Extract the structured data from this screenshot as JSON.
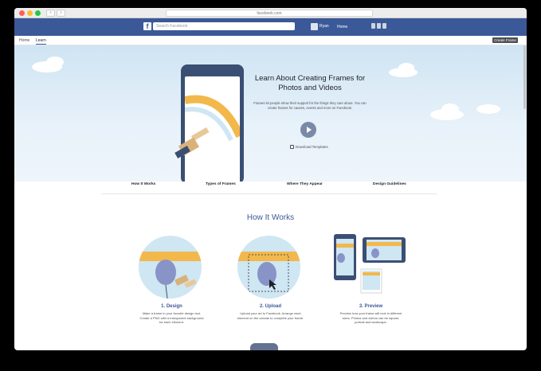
{
  "browser": {
    "url": "facebook.com",
    "back_label": "‹",
    "forward_label": "›"
  },
  "fbbar": {
    "logo": "f",
    "search_placeholder": "Search Facebook",
    "profile_name": "Ryan",
    "home_label": "Home"
  },
  "subnav": {
    "home_label": "Home",
    "learn_label": "Learn",
    "create_label": "Create Frame"
  },
  "hero": {
    "title": "Learn About Creating Frames for Photos and Videos",
    "body": "Frames let people show their support for the things they care about. You can create frames for causes, events and more on Facebook.",
    "download_label": "Download Templates"
  },
  "tabs": [
    {
      "label": "How It Works"
    },
    {
      "label": "Types of Frames"
    },
    {
      "label": "Where They Appear"
    },
    {
      "label": "Design Guidelines"
    }
  ],
  "how_it_works": {
    "title": "How It Works",
    "steps": [
      {
        "title": "1. Design",
        "body": "Make a frame in your favorite design tool. Create a PNG with a transparent background for each element."
      },
      {
        "title": "2. Upload",
        "body": "Upload your art to Facebook. Arrange each element on the canvas to complete your frame."
      },
      {
        "title": "3. Preview",
        "body": "Preview how your frame will look in different sizes. Photos and videos can be square, portrait and landscape."
      }
    ]
  },
  "colors": {
    "fb_blue": "#3b5998",
    "hero_sky": "#cfe4f3",
    "accent_yellow": "#f2b84b",
    "balloon": "#8893c7"
  }
}
